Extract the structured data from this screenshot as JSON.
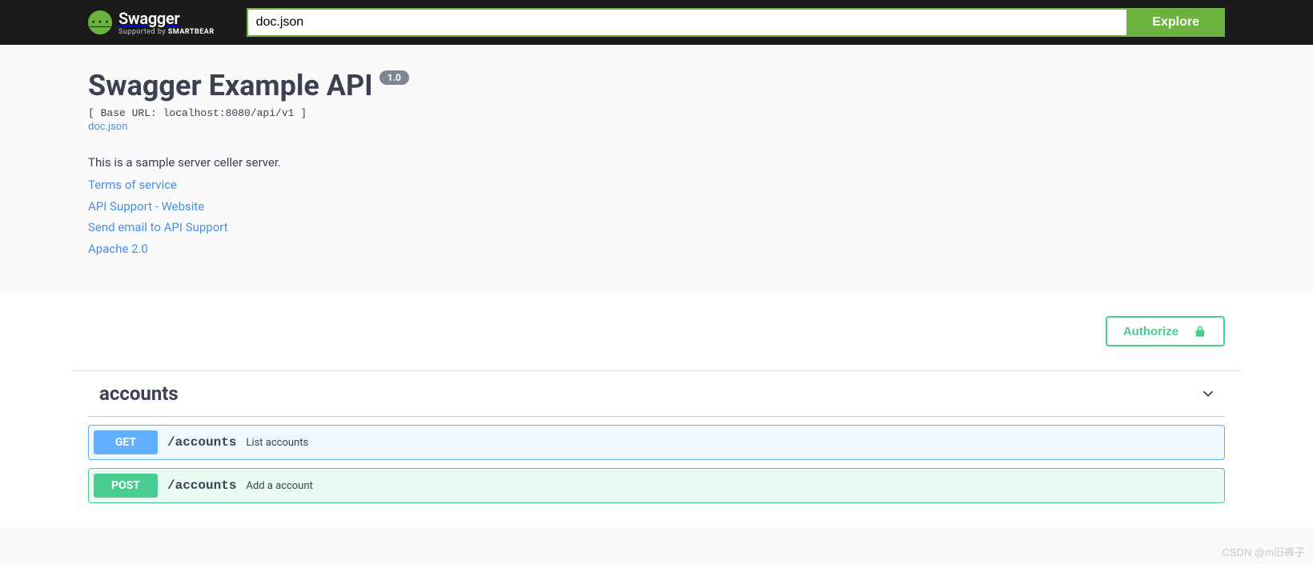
{
  "topbar": {
    "logo_braces": "{···}",
    "logo_title": "Swagger",
    "logo_sub_prefix": "Supported by ",
    "logo_sub_brand": "SMARTBEAR",
    "url_value": "doc.json",
    "explore_label": "Explore"
  },
  "info": {
    "title": "Swagger Example API",
    "version": "1.0",
    "base_url": "[ Base URL: localhost:8080/api/v1 ]",
    "spec_link": "doc.json",
    "description": "This is a sample server celler server.",
    "links": {
      "terms": "Terms of service",
      "support_site": "API Support - Website",
      "support_email": "Send email to API Support",
      "license": "Apache 2.0"
    }
  },
  "auth": {
    "authorize_label": "Authorize"
  },
  "tags": [
    {
      "name": "accounts"
    }
  ],
  "operations": [
    {
      "method": "GET",
      "path": "/accounts",
      "summary": "List accounts"
    },
    {
      "method": "POST",
      "path": "/accounts",
      "summary": "Add a account"
    }
  ],
  "watermark": "CSDN @m旧裤子"
}
